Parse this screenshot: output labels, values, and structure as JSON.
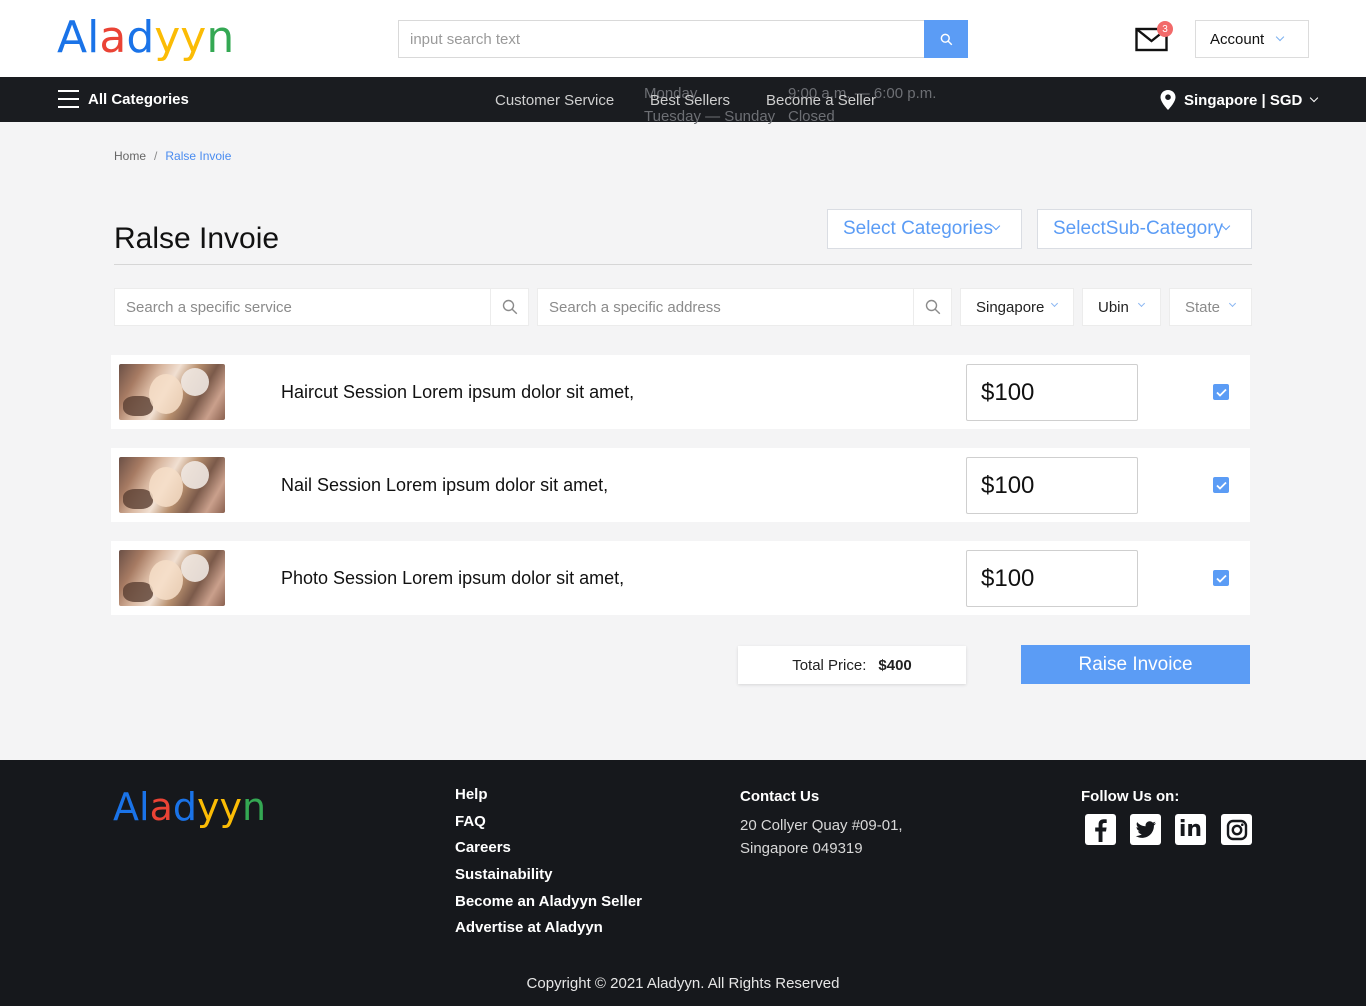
{
  "brand": {
    "letters": [
      "A",
      "l",
      "a",
      "d",
      "y",
      "y",
      "n"
    ],
    "letter_colors": [
      "#1a73e8",
      "#1a73e8",
      "#ea4335",
      "#1a73e8",
      "#fbbc05",
      "#fbbc05",
      "#34a853"
    ]
  },
  "header": {
    "search_placeholder": "input search text",
    "mail_badge": "3",
    "account_label": "Account"
  },
  "navbar": {
    "all_categories": "All Categories",
    "links": [
      "Customer Service",
      "Best Sellers",
      "Become a Seller"
    ],
    "hours_overlay": {
      "days1": "Monday",
      "days2": "Tuesday — Sunday",
      "hours1": "9:00 a.m. — 6:00 p.m.",
      "hours2": "Closed"
    },
    "location": "Singapore | SGD"
  },
  "breadcrumb": {
    "home": "Home",
    "separator": "/",
    "current": "Ralse Invoie"
  },
  "page": {
    "title": "Ralse Invoie",
    "category_select": "Select Categories",
    "subcategory_select": "SelectSub-Category"
  },
  "filters": {
    "service_placeholder": "Search a specific service",
    "address_placeholder": "Search a specific address",
    "country": "Singapore",
    "area": "Ubin",
    "state": "State"
  },
  "items": [
    {
      "title": "Haircut Session Lorem ipsum dolor sit amet,",
      "price": "$100",
      "checked": true
    },
    {
      "title": "Nail Session Lorem ipsum dolor sit amet,",
      "price": "$100",
      "checked": true
    },
    {
      "title": "Photo Session Lorem ipsum dolor sit amet,",
      "price": "$100",
      "checked": true
    }
  ],
  "summary": {
    "total_label": "Total Price:",
    "total_value": "$400",
    "raise_button": "Raise Invoice"
  },
  "footer": {
    "links": [
      "Help",
      "FAQ",
      "Careers",
      "Sustainability",
      "Become an Aladyyn Seller",
      "Advertise at Aladyyn"
    ],
    "contact_heading": "Contact Us",
    "address_line1": "20 Collyer Quay #09-01,",
    "address_line2": "Singapore 049319",
    "follow_heading": "Follow Us on:",
    "social": [
      "facebook-icon",
      "twitter-icon",
      "linkedin-icon",
      "instagram-icon"
    ],
    "copyright": "Copyright © 2021 Aladyyn. All Rights Reserved"
  },
  "colors": {
    "accent": "#5b9cf5",
    "dark": "#1a1c20",
    "footer_bg": "#16181c"
  }
}
